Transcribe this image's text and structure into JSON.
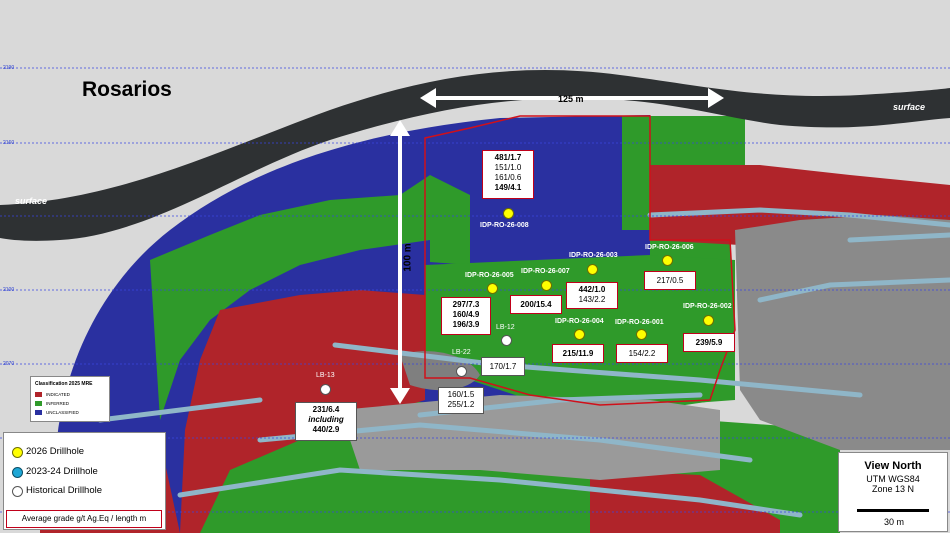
{
  "title": "Rosarios",
  "labels": {
    "surface_left": "surface",
    "surface_right": "surface",
    "width_dimension": "125 m",
    "height_dimension": "100 m"
  },
  "elevations": [
    "2190",
    "2160",
    "2130",
    "2100",
    "2070",
    "2040"
  ],
  "drillholes_2026": [
    {
      "name": "IDP-RO-26-008",
      "intercepts": [
        "481/1.7",
        "151/1.0",
        "161/0.6",
        "149/4.1"
      ]
    },
    {
      "name": "IDP-RO-26-003",
      "intercepts": [
        "442/1.0",
        "143/2.2"
      ]
    },
    {
      "name": "IDP-RO-26-006",
      "intercepts": [
        "217/0.5"
      ]
    },
    {
      "name": "IDP-RO-26-005",
      "intercepts": [
        "297/7.3",
        "160/4.9",
        "196/3.9"
      ]
    },
    {
      "name": "IDP-RO-26-007",
      "intercepts": [
        "200/15.4"
      ]
    },
    {
      "name": "IDP-RO-26-002",
      "intercepts": [
        "239/5.9"
      ]
    },
    {
      "name": "IDP-RO-26-004",
      "intercepts": [
        "215/11.9"
      ]
    },
    {
      "name": "IDP-RO-26-001",
      "intercepts": [
        "154/2.2"
      ]
    }
  ],
  "historical_drillholes": [
    {
      "name": "LB-12",
      "intercepts": [
        "170/1.7"
      ]
    },
    {
      "name": "LB-22",
      "intercepts": [
        "160/1.5",
        "255/1.2"
      ]
    },
    {
      "name": "LB-13",
      "intercepts": [
        "231/6.4",
        "including",
        "440/2.9"
      ]
    }
  ],
  "classification_legend": {
    "title": "Classification 2025 MRE",
    "items": [
      {
        "label": "INDICATED",
        "color": "#b0242a"
      },
      {
        "label": "INFERRED",
        "color": "#2f9a2a"
      },
      {
        "label": "UNCLASSIFIED",
        "color": "#2a30a0"
      }
    ]
  },
  "legend": {
    "items": [
      {
        "label": "2026 Drillhole",
        "color": "#ffff00"
      },
      {
        "label": "2023-24 Drillhole",
        "color": "#1ea7d6"
      },
      {
        "label": "Historical Drillhole",
        "color": "#ffffff"
      }
    ],
    "grade_note": "Average grade g/t Ag.Eq / length m"
  },
  "view": {
    "direction": "View North",
    "datum": "UTM WGS84",
    "zone": "Zone 13 N",
    "scale_label": "30 m"
  },
  "colors": {
    "indicated": "#b0242a",
    "inferred": "#2f9a2a",
    "unclassified": "#2a30a0",
    "boundary": "#d0101a",
    "gridline": "#3a46e0"
  }
}
